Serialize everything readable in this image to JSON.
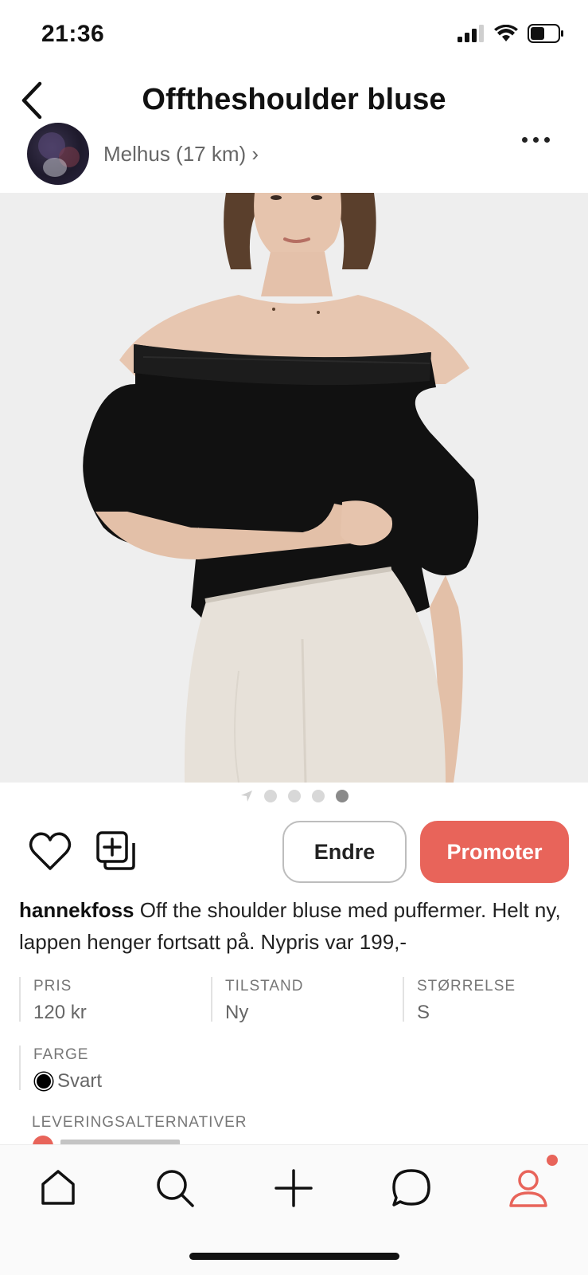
{
  "status_bar": {
    "time": "21:36"
  },
  "header": {
    "title": "Offtheshoulder bluse"
  },
  "seller": {
    "location": "Melhus (17 km) ›"
  },
  "carousel": {
    "count": 4,
    "active_index": 3
  },
  "actions": {
    "edit_label": "Endre",
    "promote_label": "Promoter"
  },
  "description": {
    "username": "hannekfoss",
    "text": " Off the shoulder bluse med puffermer. Helt ny, lappen henger fortsatt på. Nypris var 199,-"
  },
  "attributes": {
    "price": {
      "label": "PRIS",
      "value": "120 kr"
    },
    "condition": {
      "label": "TILSTAND",
      "value": "Ny"
    },
    "size": {
      "label": "STØRRELSE",
      "value": "S"
    },
    "color": {
      "label": "FARGE",
      "value": "Svart"
    }
  },
  "delivery": {
    "label": "LEVERINGSALTERNATIVER"
  },
  "tabs": [
    {
      "name": "home-icon"
    },
    {
      "name": "search-icon"
    },
    {
      "name": "plus-icon"
    },
    {
      "name": "chat-icon"
    },
    {
      "name": "profile-icon",
      "active": true
    }
  ],
  "colors": {
    "accent": "#e8645a",
    "text": "#111111",
    "muted": "#777777"
  }
}
